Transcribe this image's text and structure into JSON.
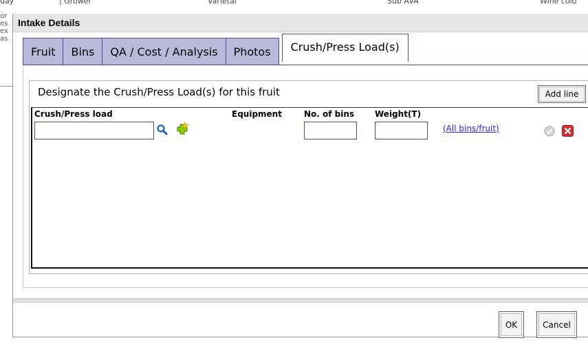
{
  "background": {
    "headers": [
      "uay",
      "Grower",
      "Varietal",
      "Sub AVA",
      "Wine colo"
    ],
    "left_fragments": [
      "or",
      "es",
      "ex",
      "as"
    ]
  },
  "dialog": {
    "title": "Intake Details",
    "tabs": [
      {
        "label": "Fruit",
        "active": false
      },
      {
        "label": "Bins",
        "active": false
      },
      {
        "label": "QA / Cost / Analysis",
        "active": false
      },
      {
        "label": "Photos",
        "active": false
      },
      {
        "label": "Crush/Press Load(s)",
        "active": true
      }
    ],
    "section_title": "Designate the Crush/Press Load(s) for this fruit",
    "add_line_label": "Add line",
    "columns": {
      "crush_press_load": "Crush/Press load",
      "equipment": "Equipment",
      "no_of_bins": "No. of bins",
      "weight": "Weight(T)"
    },
    "row": {
      "crush_press_load_value": "",
      "no_of_bins_value": "",
      "weight_value": "",
      "all_bins_link": "(All bins/fruit)"
    },
    "ok_label": "OK",
    "cancel_label": "Cancel"
  },
  "colors": {
    "tab_inactive": "#b9b9d9",
    "tab_border": "#4a4a9a",
    "link": "#2222ee",
    "delete_red": "#d03030",
    "add_green": "#7cc000"
  }
}
